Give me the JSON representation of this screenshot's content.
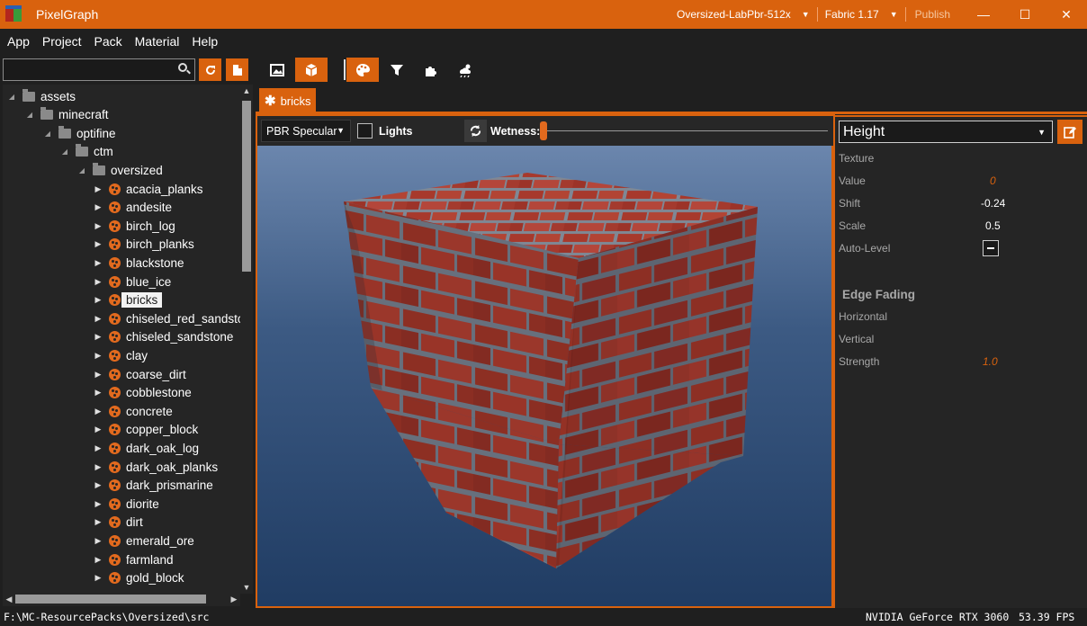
{
  "window": {
    "title": "PixelGraph",
    "profile": "Oversized-LabPbr-512x",
    "game_version": "Fabric 1.17",
    "publish_label": "Publish",
    "minimize": "—",
    "maximize": "☐",
    "close": "✕"
  },
  "menu": [
    "App",
    "Project",
    "Pack",
    "Material",
    "Help"
  ],
  "search": {
    "value": "",
    "placeholder": ""
  },
  "tree": {
    "folders": [
      "assets",
      "minecraft",
      "optifine",
      "ctm",
      "oversized"
    ],
    "items": [
      "acacia_planks",
      "andesite",
      "birch_log",
      "birch_planks",
      "blackstone",
      "blue_ice",
      "bricks",
      "chiseled_red_sandstc",
      "chiseled_sandstone",
      "clay",
      "coarse_dirt",
      "cobblestone",
      "concrete",
      "copper_block",
      "dark_oak_log",
      "dark_oak_planks",
      "dark_prismarine",
      "diorite",
      "dirt",
      "emerald_ore",
      "farmland",
      "gold_block"
    ],
    "selected": "bricks"
  },
  "toolbar": {
    "buttons": [
      "image-icon",
      "cube-icon",
      "palette-icon",
      "filter-icon",
      "puzzle-icon",
      "weather-icon"
    ],
    "active": [
      "cube-icon",
      "palette-icon"
    ]
  },
  "tab": {
    "label": "bricks",
    "marker": "✱"
  },
  "viewport": {
    "mode_select": "PBR Specular",
    "lights_label": "Lights",
    "lights_checked": false,
    "wetness_label": "Wetness:",
    "wetness_level": 0
  },
  "properties": {
    "channel_select": "Height",
    "texture_label": "Texture",
    "value_label": "Value",
    "value": "0",
    "shift_label": "Shift",
    "shift": "-0.24",
    "scale_label": "Scale",
    "scale": "0.5",
    "autolevel_label": "Auto-Level",
    "edge_fading_title": "Edge Fading",
    "horizontal_label": "Horizontal",
    "vertical_label": "Vertical",
    "strength_label": "Strength",
    "strength": "1.0"
  },
  "status": {
    "path": "F:\\MC-ResourcePacks\\Oversized\\src",
    "gpu": "NVIDIA GeForce RTX 3060",
    "fps": "53.39 FPS"
  },
  "colors": {
    "accent": "#d9620e",
    "background": "#1f1f1f",
    "panel": "#252525",
    "brick": "#a8382c",
    "mortar": "#7d8796"
  }
}
